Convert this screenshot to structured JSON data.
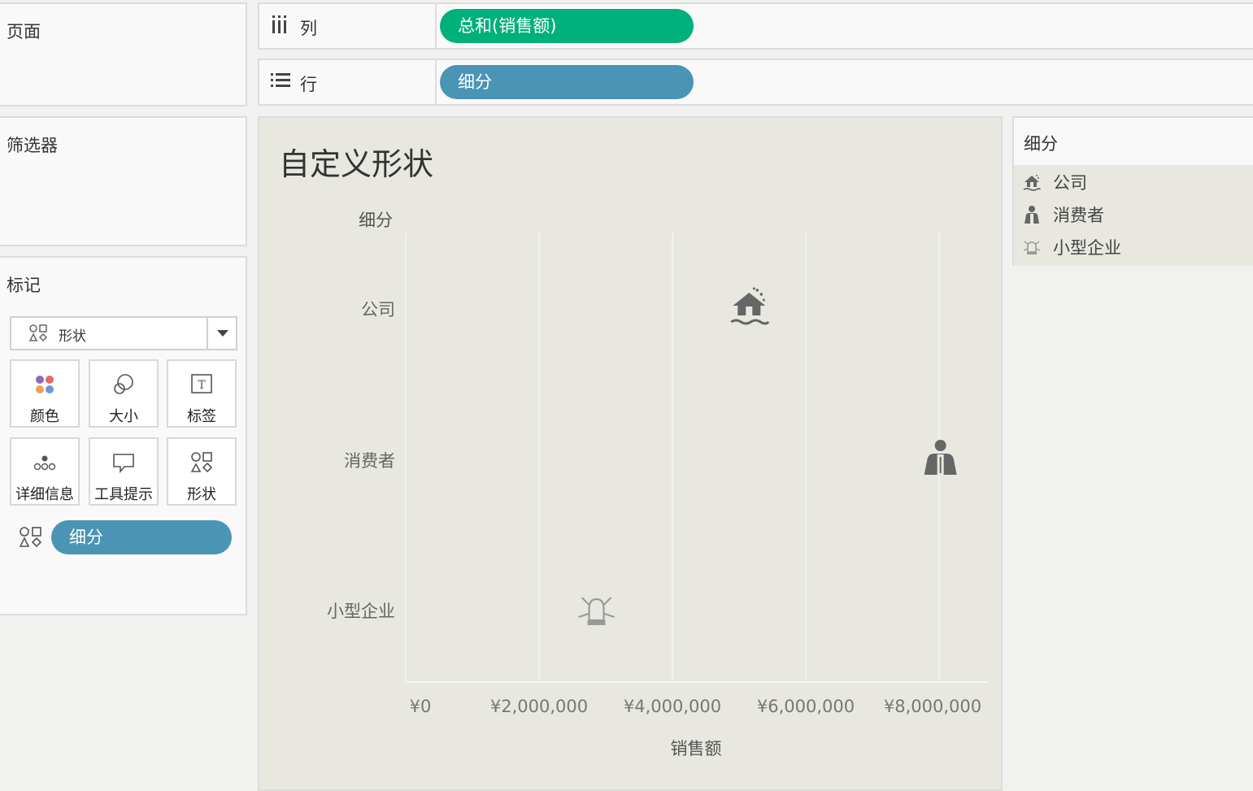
{
  "panels": {
    "pages_title": "页面",
    "filters_title": "筛选器",
    "marks_title": "标记"
  },
  "shelves": {
    "columns_label": "列",
    "columns_pill": "总和(销售额)",
    "rows_label": "行",
    "rows_pill": "细分"
  },
  "marks": {
    "mark_type": "形状",
    "cards": [
      "颜色",
      "大小",
      "标签",
      "详细信息",
      "工具提示",
      "形状"
    ],
    "shape_field": "细分"
  },
  "view": {
    "title": "自定义形状",
    "row_header": "细分"
  },
  "legend": {
    "title": "细分",
    "items": [
      {
        "label": "公司",
        "icon": "house-flood-icon"
      },
      {
        "label": "消费者",
        "icon": "person-icon"
      },
      {
        "label": "小型企业",
        "icon": "alarm-bell-icon"
      }
    ]
  },
  "chart_data": {
    "type": "scatter",
    "categories": [
      "公司",
      "消费者",
      "小型企业"
    ],
    "values": [
      5150000,
      8020000,
      2860000
    ],
    "xlabel": "销售额",
    "ylabel": "细分",
    "x_ticks": [
      "¥0",
      "¥2,000,000",
      "¥4,000,000",
      "¥6,000,000",
      "¥8,000,000"
    ],
    "xlim": [
      0,
      8800000
    ],
    "grid": true,
    "legend": "right"
  },
  "colors": {
    "accent_green": "#00b07a",
    "accent_blue": "#4a95b5",
    "view_bg": "#e8e8e0",
    "mark_dark": "#666666",
    "mark_light": "#aaaaaa"
  }
}
